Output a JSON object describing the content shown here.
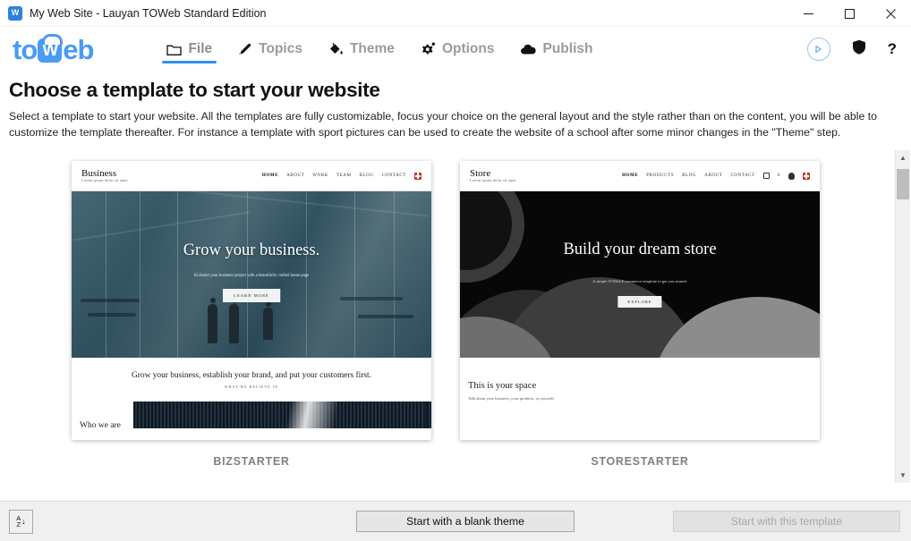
{
  "window": {
    "title": "My Web Site - Lauyan TOWeb Standard Edition",
    "app_icon": "toweb-app-icon",
    "minimize": "—",
    "maximize": "□",
    "close": "✕"
  },
  "brand": {
    "text_left": "to",
    "boxed_letter": "W",
    "text_right": "eb"
  },
  "nav": {
    "tabs": [
      {
        "label": "File",
        "icon": "folder-icon",
        "active": true
      },
      {
        "label": "Topics",
        "icon": "pencil-icon",
        "active": false
      },
      {
        "label": "Theme",
        "icon": "paint-bucket-icon",
        "active": false
      },
      {
        "label": "Options",
        "icon": "gear-icon",
        "active": false
      },
      {
        "label": "Publish",
        "icon": "cloud-upload-icon",
        "active": false
      }
    ],
    "tools": [
      {
        "name": "preview-play-icon",
        "glyph": "▶"
      },
      {
        "name": "shield-icon",
        "glyph": "⬟"
      },
      {
        "name": "help-icon",
        "glyph": "?"
      }
    ]
  },
  "page": {
    "title": "Choose a template to start your website",
    "description": "Select a template to start your website. All the templates are fully customizable, focus your choice on the general layout and the style rather than on the content, you will be able to customize the template thereafter. For instance a template with sport pictures can be used to create the website of a school after some minor changes in the \"Theme\" step."
  },
  "templates": [
    {
      "id": "bizstarter",
      "label": "BIZSTARTER",
      "preview": {
        "brand_name": "Business",
        "brand_tagline": "Lorem ipsum dolor sit amet",
        "nav_items": [
          "HOME",
          "ABOUT",
          "WORK",
          "TEAM",
          "BLOG",
          "CONTACT"
        ],
        "flag_icon": "swiss-flag-icon",
        "hero_title": "Grow your business.",
        "hero_subtitle": "Kickstart your business project with a beautifully crafted home page",
        "hero_button": "LEARN MORE",
        "section_slogan": "Grow your business, establish your brand, and put your customers first.",
        "section_kicker": "WHAT WE BELIEVE IN",
        "section_heading": "Who we are"
      }
    },
    {
      "id": "storestarter",
      "label": "STORESTARTER",
      "preview": {
        "brand_name": "Store",
        "brand_tagline": "Lorem ipsum dolor sit amet",
        "nav_items": [
          "HOME",
          "PRODUCTS",
          "BLOG",
          "ABOUT",
          "CONTACT"
        ],
        "cart_icon": "shopping-cart-icon",
        "cart_count": "0",
        "account_icon": "user-account-icon",
        "flag_icon": "swiss-flag-icon",
        "hero_title": "Build your dream store",
        "hero_subtitle": "A simple TOWeb Ecommerce template to get you started.",
        "hero_button": "EXPLORE",
        "section_heading": "This is your space",
        "section_text": "Talk about your business, your products, or yourself."
      }
    }
  ],
  "scrollbar": {
    "up_arrow": "▲",
    "down_arrow": "▼"
  },
  "footer": {
    "sort_button": {
      "name": "sort-az-button",
      "top_letter": "A",
      "bottom_letter": "Z",
      "arrow": "↓"
    },
    "blank_theme_button": "Start with a blank theme",
    "apply_template_button": "Start with this template"
  },
  "colors": {
    "accent_blue": "#2f8ff0",
    "logo_blue": "#4a9bf5",
    "tab_text": "#9b9b9b",
    "label_gray": "#7b8287",
    "disabled_text": "#a8a8a8"
  }
}
